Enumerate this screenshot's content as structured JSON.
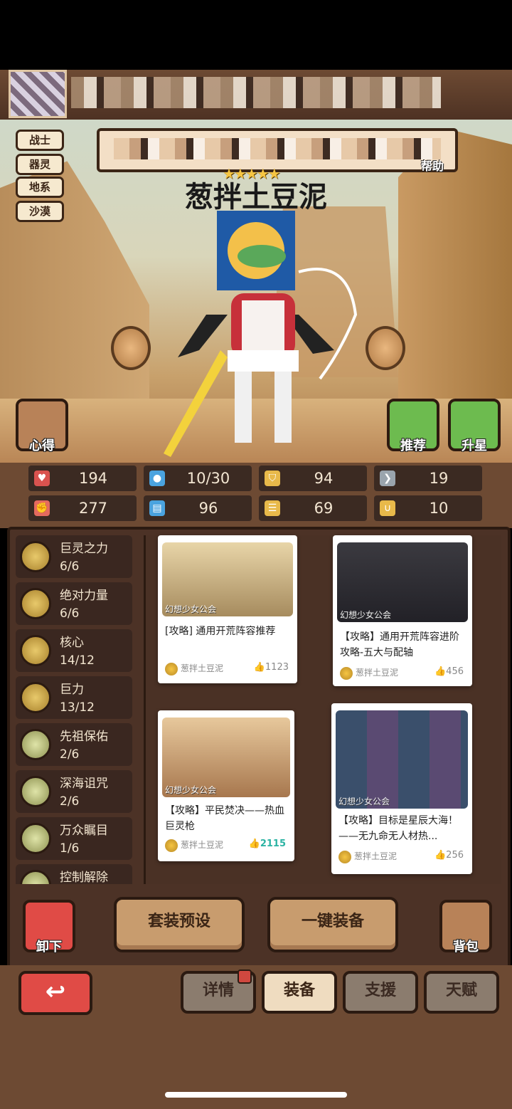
{
  "hero": {
    "tags": [
      "战士",
      "器灵",
      "地系",
      "沙漠"
    ],
    "name": "葱拌土豆泥",
    "stars": "★★★★★",
    "help_label": "帮助",
    "side_buttons": {
      "notes": "心得",
      "recommend": "推荐",
      "star_up": "升星"
    }
  },
  "stats": [
    {
      "icon": "heart-icon",
      "symbol": "♥",
      "color": "#d9534f",
      "value": "194"
    },
    {
      "icon": "mana-drop-icon",
      "symbol": "💧",
      "color": "#4aa3df",
      "value": "10/30"
    },
    {
      "icon": "shield-icon",
      "symbol": "⛉",
      "color": "#e8b94a",
      "value": "94"
    },
    {
      "icon": "wing-icon",
      "symbol": "❯",
      "color": "#cfd8e0",
      "value": "19"
    },
    {
      "icon": "fist-icon",
      "symbol": "✊",
      "color": "#e46a5e",
      "value": "277"
    },
    {
      "icon": "book-icon",
      "symbol": "▤",
      "color": "#4aa3df",
      "value": "96"
    },
    {
      "icon": "stairs-icon",
      "symbol": "☰",
      "color": "#e8b94a",
      "value": "69"
    },
    {
      "icon": "horseshoe-icon",
      "symbol": "∪",
      "color": "#e8b94a",
      "value": "10"
    }
  ],
  "skills": [
    {
      "name": "巨灵之力",
      "count": "6/6"
    },
    {
      "name": "绝对力量",
      "count": "6/6"
    },
    {
      "name": "核心",
      "count": "14/12"
    },
    {
      "name": "巨力",
      "count": "13/12"
    },
    {
      "name": "先祖保佑",
      "count": "2/6"
    },
    {
      "name": "深海诅咒",
      "count": "2/6"
    },
    {
      "name": "万众瞩目",
      "count": "1/6"
    },
    {
      "name": "控制解除",
      "count": ""
    }
  ],
  "cards": [
    {
      "title": "[攻略] 通用开荒阵容推荐",
      "author": "葱拌土豆泥",
      "likes": "1123",
      "watermark": "幻想少女公会"
    },
    {
      "title": "【攻略】通用开荒阵容进阶攻略-五大与配轴",
      "author": "葱拌土豆泥",
      "likes": "456",
      "watermark": "幻想少女公会"
    },
    {
      "title": "【攻略】平民焚决——热血巨灵枪",
      "author": "葱拌土豆泥",
      "likes": "2115",
      "watermark": "幻想少女公会"
    },
    {
      "title": "【攻略】目标是星辰大海！——无九命无人材热...",
      "author": "葱拌土豆泥",
      "likes": "256",
      "watermark": "幻想少女公会"
    }
  ],
  "actions": {
    "unload": "卸下",
    "preset": "套装预设",
    "auto_equip": "一键装备",
    "bag": "背包"
  },
  "tabs": [
    "详情",
    "装备",
    "支援",
    "天赋"
  ],
  "colors": {
    "active_tab": "#efdcc0",
    "panel": "#4c3226",
    "accent_red": "#e04b46",
    "like_active": "#2bb3a3"
  }
}
